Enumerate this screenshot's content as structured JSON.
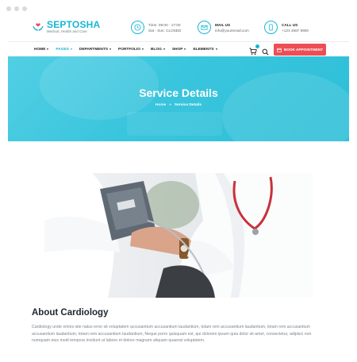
{
  "brand": {
    "name": "SEPTOSHA",
    "tagline": "Medical, Health and Care",
    "accent": "#17b6d6",
    "cta_color": "#ee4d55"
  },
  "topbar": {
    "hours": {
      "icon": "clock-icon",
      "line1": "Time: 09:00 - 17:00",
      "line2": "Sat - Sun: CLOSED"
    },
    "mail": {
      "icon": "mail-icon",
      "title": "MAIL US",
      "value": "info@youremail.com"
    },
    "call": {
      "icon": "phone-icon",
      "title": "CALL US",
      "value": "+123 4567 8900"
    }
  },
  "nav": {
    "items": [
      {
        "label": "HOME",
        "dropdown": true
      },
      {
        "label": "PAGES",
        "dropdown": true,
        "active": true
      },
      {
        "label": "DEPARTMENTS",
        "dropdown": true
      },
      {
        "label": "PORTFOLIO",
        "dropdown": true
      },
      {
        "label": "BLOG",
        "dropdown": true
      },
      {
        "label": "SHOP",
        "dropdown": true
      },
      {
        "label": "ELEMENTS",
        "dropdown": true
      }
    ],
    "cta_label": "BOOK APPOINTMENT"
  },
  "hero": {
    "title": "Service Details",
    "breadcrumb": {
      "home": "Home",
      "separator": "»",
      "current": "Service Details"
    }
  },
  "about": {
    "title": "About Cardiology",
    "text": "Cardiology unde omnis iste natus error sit voluptatem accusantium accusantium laudantium, totam rem accusantium laudantium, totam rem accusantium accusantium laudantium, totam rem accusantium laudantium, Neque porro quisquam est, qui dolorem ipsum quia dolor sit amet, consectetur, adipisci non numquam eius modi tempora incidunt ut labore et dolore magnam aliquam quaerat voluptatem."
  }
}
